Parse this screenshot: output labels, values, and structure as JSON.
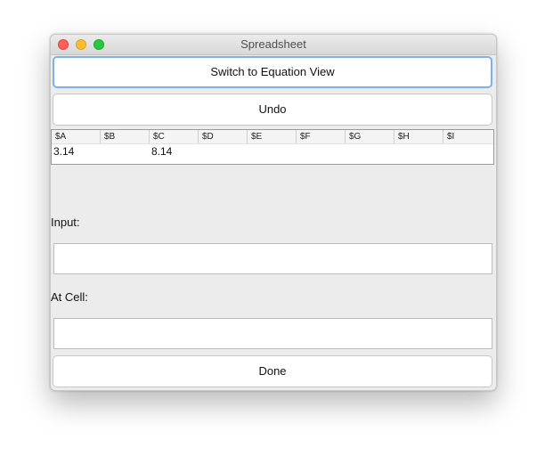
{
  "window": {
    "title": "Spreadsheet"
  },
  "buttons": {
    "switch_view": "Switch to Equation View",
    "undo": "Undo",
    "done": "Done"
  },
  "table": {
    "columns": [
      "$A",
      "$B",
      "$C",
      "$D",
      "$E",
      "$F",
      "$G",
      "$H",
      "$I"
    ],
    "rows": [
      [
        "3.14",
        "",
        "8.14",
        "",
        "",
        "",
        "",
        "",
        ""
      ]
    ]
  },
  "form": {
    "input_label": "Input:",
    "input_value": "",
    "cell_label": "At Cell:",
    "cell_value": ""
  },
  "colors": {
    "close": "#fe5f57",
    "minimize": "#febc2e",
    "maximize": "#28c840",
    "focus_ring": "#7fb0ea"
  }
}
